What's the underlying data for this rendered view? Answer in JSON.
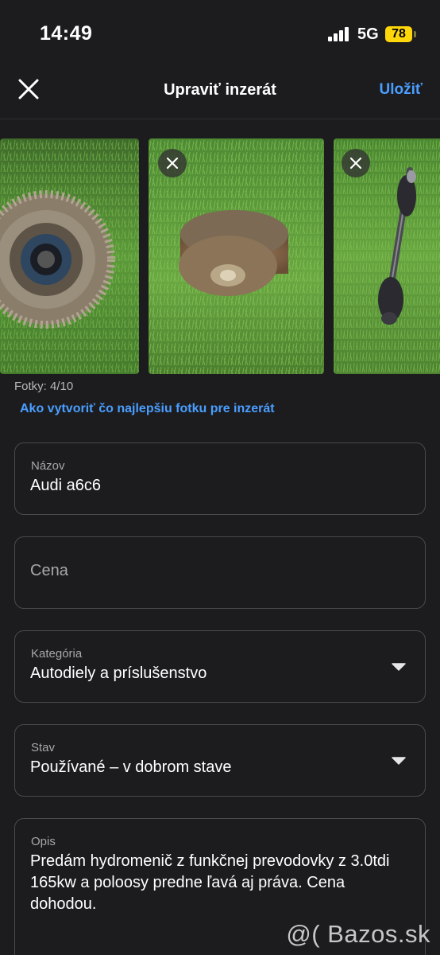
{
  "status_bar": {
    "time": "14:49",
    "network": "5G",
    "battery": "78"
  },
  "nav": {
    "title": "Upraviť inzerát",
    "save_label": "Uložiť"
  },
  "photos": {
    "count_label": "Fotky: 4/10",
    "tip_link": "Ako vytvoriť čo najlepšiu fotku pre inzerát"
  },
  "form": {
    "name": {
      "label": "Názov",
      "value": "Audi a6c6"
    },
    "price": {
      "placeholder": "Cena"
    },
    "category": {
      "label": "Kategória",
      "value": "Autodiely a príslušenstvo"
    },
    "condition": {
      "label": "Stav",
      "value": "Používané – v dobrom stave"
    },
    "description": {
      "label": "Opis",
      "value": "Predám hydromenič z funkčnej prevodovky z 3.0tdi 165kw a poloosy predne ľavá aj práva. Cena dohodou."
    }
  },
  "watermark": "@( Bazos.sk",
  "icons": {
    "close": "close-icon",
    "remove_photo": "close-icon",
    "dropdown": "caret-down-icon"
  },
  "colors": {
    "background": "#1c1c1e",
    "accent": "#4a9eff",
    "battery": "#ffd60a"
  }
}
